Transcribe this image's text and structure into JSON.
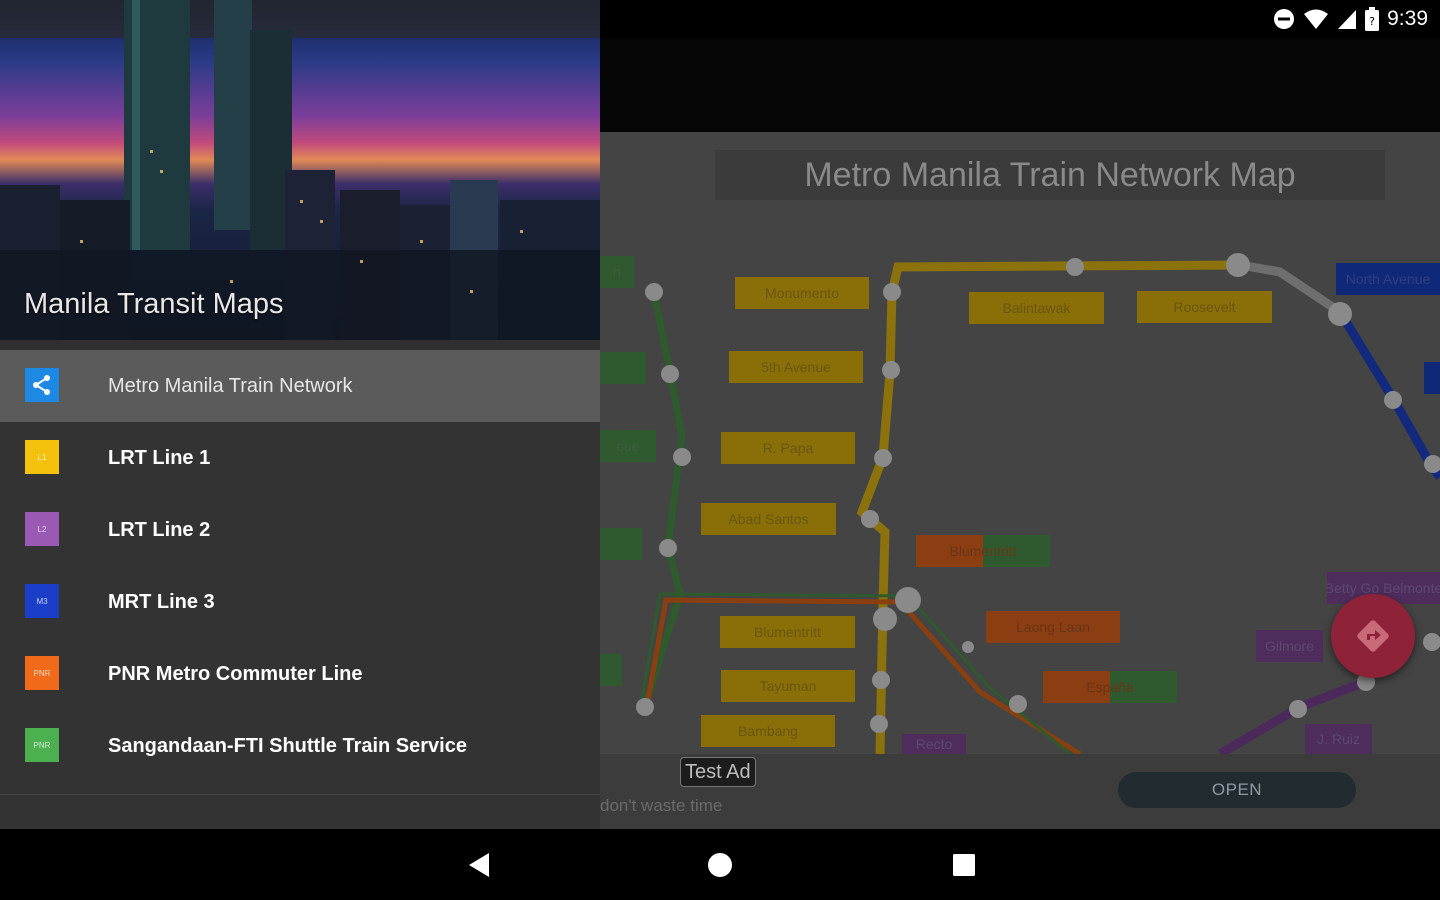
{
  "status": {
    "time": "9:39",
    "icons": [
      "dnd-icon",
      "wifi-icon",
      "signal-icon",
      "battery-icon"
    ]
  },
  "drawer": {
    "header_title": "Manila Transit Maps",
    "items": [
      {
        "label": "Metro Manila Train Network",
        "icon": "share-network-icon",
        "color": "#1e88e5",
        "badge": "",
        "selected": true
      },
      {
        "label": "LRT Line 1",
        "icon": "lrt1-icon",
        "color": "#f4c20d",
        "badge": "L1",
        "selected": false
      },
      {
        "label": "LRT Line 2",
        "icon": "lrt2-icon",
        "color": "#9b59b6",
        "badge": "L2",
        "selected": false
      },
      {
        "label": "MRT Line 3",
        "icon": "mrt3-icon",
        "color": "#1a3ec8",
        "badge": "M3",
        "selected": false
      },
      {
        "label": "PNR Metro Commuter Line",
        "icon": "pnr-icon",
        "color": "#f06a1a",
        "badge": "PNR",
        "selected": false
      },
      {
        "label": "Sangandaan-FTI Shuttle Train Service",
        "icon": "pnr-shuttle-icon",
        "color": "#4caf50",
        "badge": "PNR",
        "selected": false
      }
    ]
  },
  "map": {
    "title": "Metro Manila Train Network Map",
    "stations": {
      "monumento": "Monumento",
      "balintawak": "Balintawak",
      "roosevelt": "Roosevelt",
      "north_avenue": "North Avenue",
      "fifth_avenue": "5th Avenue",
      "r_papa": "R. Papa",
      "abad_santos": "Abad Santos",
      "blumentritt_pnr": "Blumentritt",
      "blumentritt_lrt": "Blumentritt",
      "laong_laan": "Laong Laan",
      "tayuman": "Tayuman",
      "espana": "España",
      "bambang": "Bambang",
      "recto": "Recto",
      "betty_go": "Betty Go Belmonte",
      "gilmore": "Gilmore",
      "j_ruiz": "J. Ruiz",
      "partial_n": "n",
      "partial_cue": "cue"
    }
  },
  "ad": {
    "badge": "Test Ad",
    "subtext": "don't waste time",
    "open_label": "OPEN"
  },
  "nav": {
    "back": "back-icon",
    "home": "home-icon",
    "recents": "recents-icon"
  }
}
